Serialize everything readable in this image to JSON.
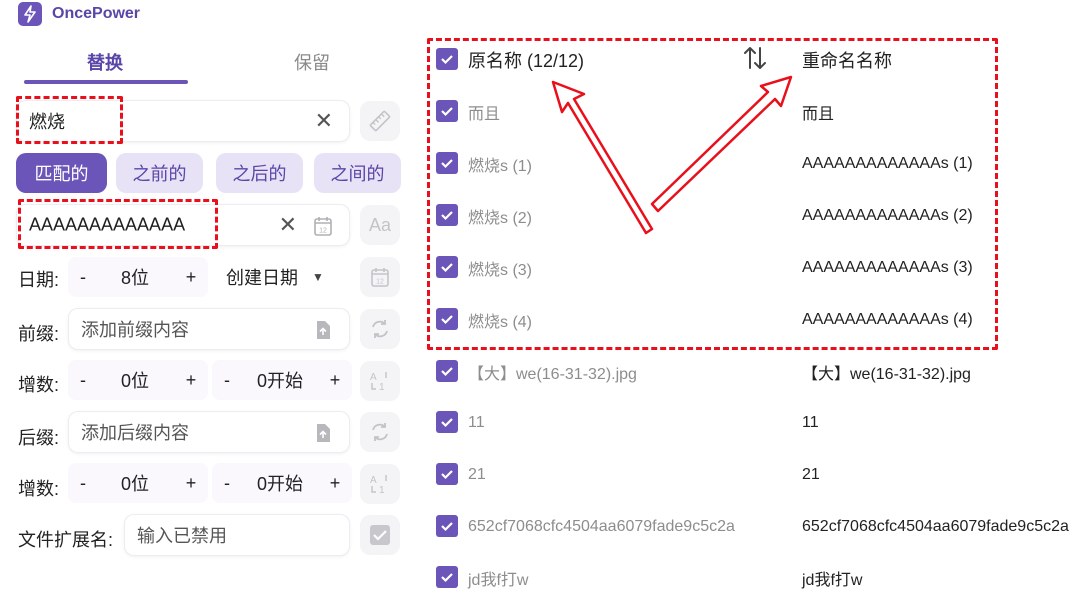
{
  "app": {
    "name": "OncePower"
  },
  "tabs": [
    {
      "label": "替换",
      "active": true
    },
    {
      "label": "保留",
      "active": false
    }
  ],
  "find": {
    "value": "燃烧"
  },
  "modes": [
    {
      "label": "匹配的",
      "active": true
    },
    {
      "label": "之前的",
      "active": false
    },
    {
      "label": "之后的",
      "active": false
    },
    {
      "label": "之间的",
      "active": false
    }
  ],
  "replace": {
    "value": "AAAAAAAAAAAAA"
  },
  "date": {
    "label": "日期:",
    "minus": "-",
    "value": "8位",
    "plus": "+",
    "type": "创建日期"
  },
  "prefix": {
    "label": "前缀:",
    "placeholder": "添加前缀内容"
  },
  "increment1": {
    "label": "增数:",
    "minus": "-",
    "digits": "0位",
    "plus": "+",
    "minus2": "-",
    "start": "0开始",
    "plus2": "+"
  },
  "suffix": {
    "label": "后缀:",
    "placeholder": "添加后缀内容"
  },
  "increment2": {
    "label": "增数:",
    "minus": "-",
    "digits": "0位",
    "plus": "+",
    "minus2": "-",
    "start": "0开始",
    "plus2": "+"
  },
  "extension": {
    "label": "文件扩展名:",
    "placeholder": "输入已禁用"
  },
  "list": {
    "header": {
      "original": "原名称 (12/12)",
      "renamed": "重命名名称"
    },
    "rows": [
      {
        "original": "而且",
        "renamed": "而且"
      },
      {
        "original": "燃烧s (1)",
        "renamed": "AAAAAAAAAAAAAs (1)"
      },
      {
        "original": "燃烧s (2)",
        "renamed": "AAAAAAAAAAAAAs (2)"
      },
      {
        "original": "燃烧s (3)",
        "renamed": "AAAAAAAAAAAAAs (3)"
      },
      {
        "original": "燃烧s (4)",
        "renamed": "AAAAAAAAAAAAAs (4)"
      },
      {
        "original": "【大】we(16-31-32).jpg",
        "renamed": "【大】we(16-31-32).jpg"
      },
      {
        "original": "11",
        "renamed": "11"
      },
      {
        "original": "21",
        "renamed": "21"
      },
      {
        "original": "652cf7068cfc4504aa6079fade9c5c2a",
        "renamed": "652cf7068cfc4504aa6079fade9c5c2a"
      },
      {
        "original": "jd我f打w",
        "renamed": "jd我f打w"
      }
    ]
  },
  "colors": {
    "accent": "#6b55b8",
    "accent_light": "#e7e2f5",
    "highlight": "#e8101a"
  }
}
